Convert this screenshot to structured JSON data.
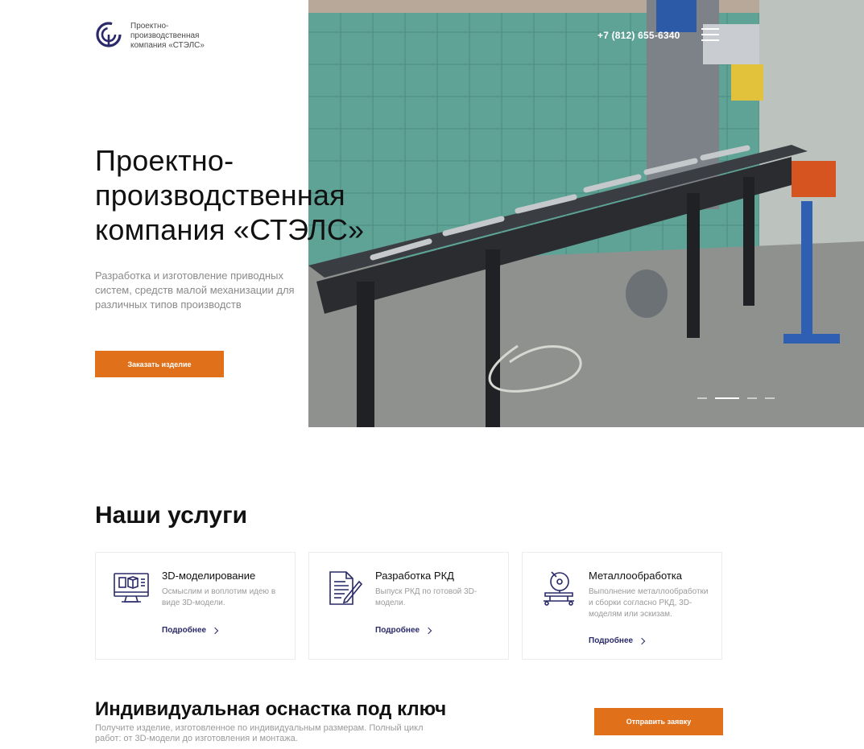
{
  "brand": {
    "logo_text": "Проектно-производственная компания «СТЭЛС»"
  },
  "header": {
    "phone": "+7 (812) 655-6340",
    "menu_icon": "hamburger-icon"
  },
  "hero": {
    "title": "Проектно-производственная компания «СТЭЛС»",
    "subtitle": "Разработка и изготовление приводных систем, средств малой механизации для различных типов производств",
    "button_label": "Заказать изделие",
    "slides_count": 4,
    "active_slide": 2
  },
  "services": {
    "title": "Наши услуги",
    "items": [
      {
        "icon": "monitor-3d-icon",
        "title": "3D-моделирование",
        "description": "Осмыслим и воплотим идею в виде 3D-модели.",
        "link_label": "Подробнее"
      },
      {
        "icon": "document-pen-icon",
        "title": "Разработка РКД",
        "description": "Выпуск РКД по готовой 3D-модели.",
        "link_label": "Подробнее"
      },
      {
        "icon": "cutting-saw-icon",
        "title": "Металлообработка",
        "description": "Выполнение металлообработки и сборки согласно РКД, 3D-моделям или эскизам.",
        "link_label": "Подробнее"
      }
    ]
  },
  "turnkey": {
    "title": "Индивидуальная оснастка под ключ",
    "description": "Получите изделие, изготовленное по индивидуальным размерам. Полный цикл работ: от 3D-модели до изготовления и монтажа.",
    "button_label": "Отправить заявку"
  },
  "colors": {
    "accent": "#e0701a",
    "icon_ink": "#2a2a6a",
    "muted_text": "#9a9a9a"
  }
}
